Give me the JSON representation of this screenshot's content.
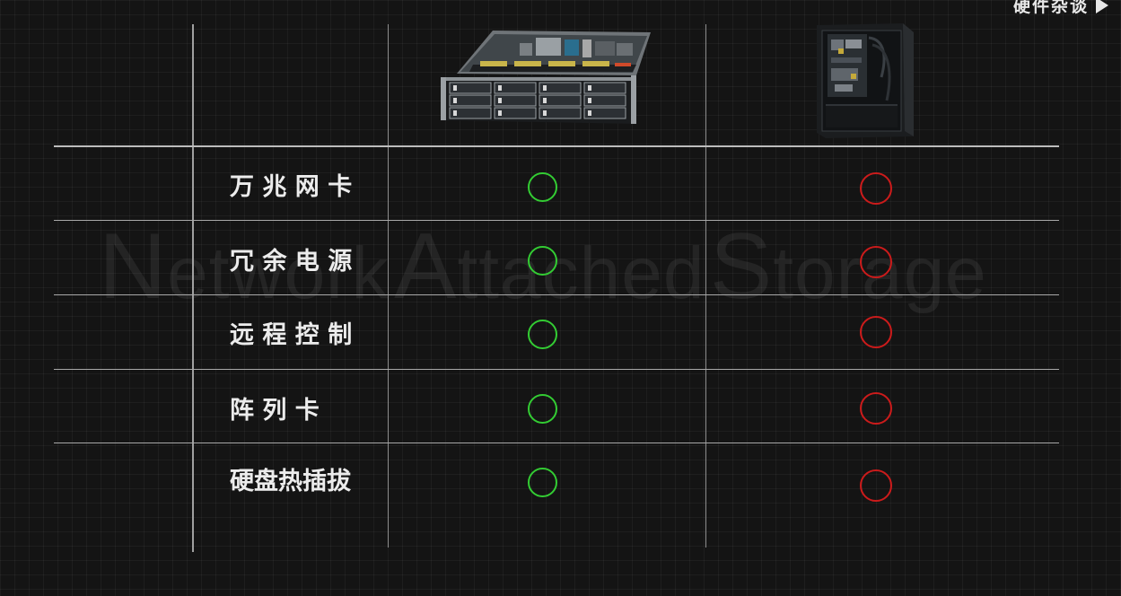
{
  "watermark": {
    "words": [
      {
        "initial": "N",
        "rest": "etwork"
      },
      {
        "initial": "A",
        "rest": "ttached"
      },
      {
        "initial": "S",
        "rest": "torage"
      }
    ]
  },
  "brand": {
    "text": "硬件杂谈",
    "icon": "play-icon"
  },
  "columns": [
    {
      "image": "rack-server-image"
    },
    {
      "image": "tower-case-image"
    }
  ],
  "rows": [
    {
      "label": "万 兆 网 卡",
      "col1": "supported",
      "col2": "not-supported"
    },
    {
      "label": "冗 余 电 源",
      "col1": "supported",
      "col2": "not-supported"
    },
    {
      "label": "远 程 控 制",
      "col1": "supported",
      "col2": "not-supported"
    },
    {
      "label": "阵   列   卡",
      "col1": "supported",
      "col2": "not-supported"
    },
    {
      "label": "硬盘热插拔",
      "col1": "supported",
      "col2": "not-supported"
    }
  ],
  "colors": {
    "supported": "#33cc33",
    "not_supported": "#cc1b1b",
    "background": "#141414"
  }
}
